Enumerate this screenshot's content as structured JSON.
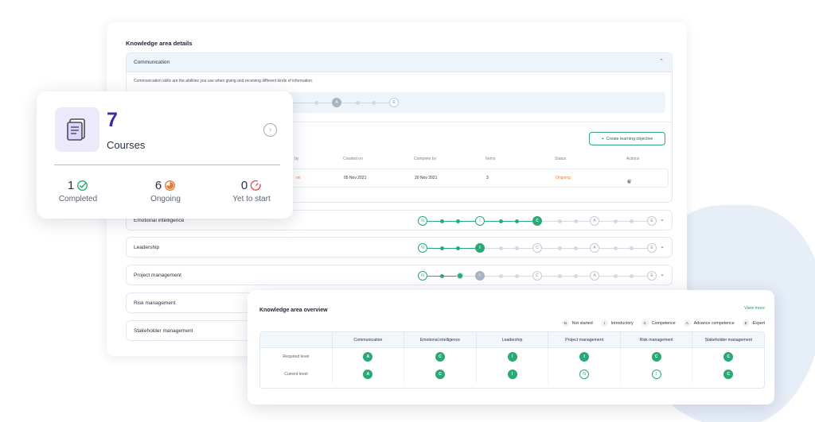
{
  "main": {
    "title": "Knowledge area details",
    "communication": {
      "title": "Communication",
      "description": "Communication skills are the abilities you use when giving and receiving different kinds of information.",
      "create_button": "Create learning objective",
      "table": {
        "headers": [
          "by",
          "Created on",
          "Complete by",
          "Items",
          "Status",
          "Actions"
        ],
        "row": {
          "by": "on",
          "created_on": "05 Nov 2021",
          "complete_by": "20 Nov 2021",
          "items": "3",
          "status": "Ongoing"
        }
      }
    },
    "areas": [
      {
        "name": "Emotional intelligence",
        "track": "N-I-C"
      },
      {
        "name": "Leadership",
        "track": "N-I"
      },
      {
        "name": "Project management",
        "track": "N-dot-I"
      },
      {
        "name": "Risk management"
      },
      {
        "name": "Stakeholder management"
      }
    ]
  },
  "course_card": {
    "count": "7",
    "label": "Courses",
    "completed": {
      "count": "1",
      "label": "Completed"
    },
    "ongoing": {
      "count": "6",
      "label": "Ongoing"
    },
    "yet": {
      "count": "0",
      "label": "Yet to start"
    }
  },
  "overview": {
    "title": "Knowledge area overview",
    "view_more": "View more",
    "legend": [
      {
        "key": "N",
        "label": "Not started"
      },
      {
        "key": "I",
        "label": "Introductory"
      },
      {
        "key": "C",
        "label": "Competence"
      },
      {
        "key": "A",
        "label": "Advance competence"
      },
      {
        "key": "E",
        "label": "Expert"
      }
    ],
    "columns": [
      "Communication",
      "Emotional intelligence",
      "Leadership",
      "Project management",
      "Risk management",
      "Stakeholder management"
    ],
    "rows": [
      {
        "label": "Required level",
        "values": [
          "A",
          "C",
          "I",
          "I",
          "C",
          "C"
        ],
        "styles": [
          "fill",
          "fill",
          "fill",
          "fill",
          "fill",
          "fill"
        ]
      },
      {
        "label": "Current level",
        "values": [
          "A",
          "C",
          "I",
          "N",
          "I",
          "C"
        ],
        "styles": [
          "fill",
          "fill",
          "fill",
          "outline",
          "outline",
          "fill"
        ]
      }
    ]
  },
  "colors": {
    "accent_green": "#2aa977",
    "purple": "#3b2b9e",
    "ongoing_orange": "#e07c3c"
  }
}
